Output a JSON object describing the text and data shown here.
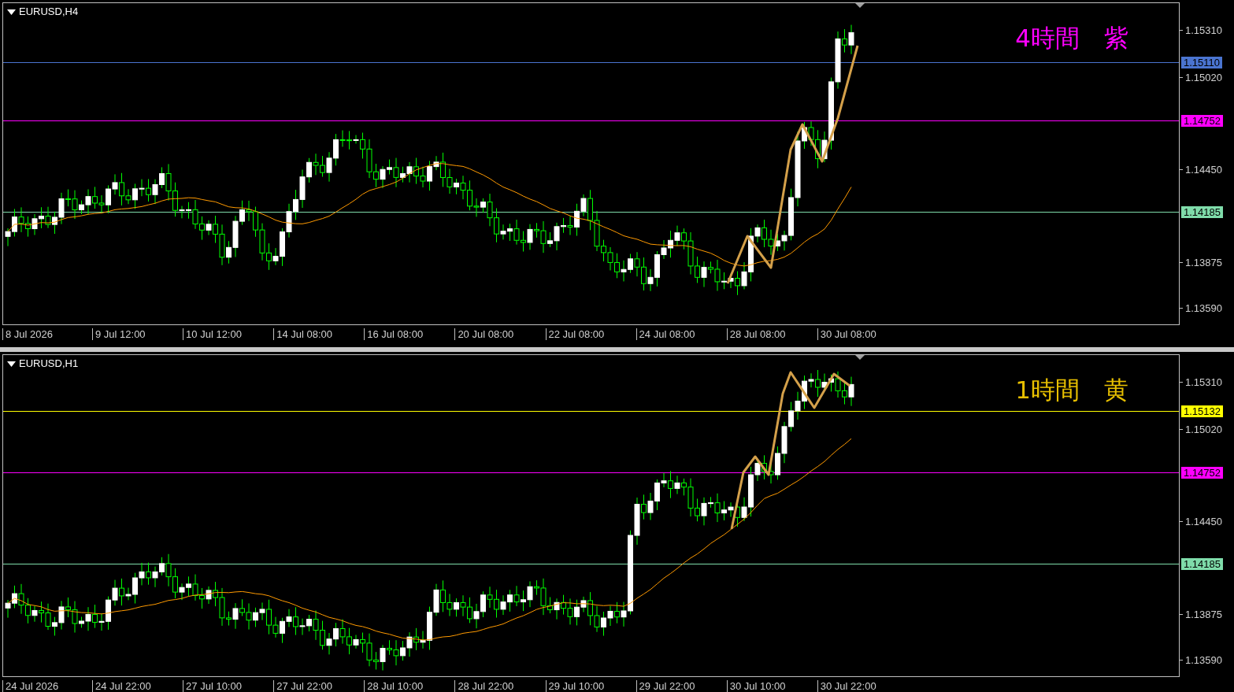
{
  "panels": [
    {
      "title": "EURUSD,H4",
      "annotation": {
        "text": "4時間　紫",
        "color": "#ff00ff"
      },
      "price_labels": [
        {
          "kind": "tick",
          "text": "1.15310"
        },
        {
          "kind": "level",
          "text": "1.15110",
          "color": "#4a74d0"
        },
        {
          "kind": "tick",
          "text": "1.15020"
        },
        {
          "kind": "level",
          "text": "1.14752",
          "color": "#ff00ff"
        },
        {
          "kind": "tick",
          "text": "1.14450"
        },
        {
          "kind": "level",
          "text": "1.14185",
          "color": "#7fdcaa"
        },
        {
          "kind": "tick",
          "text": "1.13875"
        },
        {
          "kind": "tick",
          "text": "1.13590"
        }
      ],
      "time_labels": [
        "8 Jul 2026",
        "9 Jul 12:00",
        "10 Jul 12:00",
        "14 Jul 08:00",
        "16 Jul 08:00",
        "20 Jul 08:00",
        "22 Jul 08:00",
        "24 Jul 08:00",
        "28 Jul 08:00",
        "30 Jul 08:00"
      ]
    },
    {
      "title": "EURUSD,H1",
      "annotation": {
        "text": "1時間　黄",
        "color": "#e8c000"
      },
      "price_labels": [
        {
          "kind": "tick",
          "text": "1.15310"
        },
        {
          "kind": "level",
          "text": "1.15132",
          "color": "#ffff00"
        },
        {
          "kind": "tick",
          "text": "1.15020"
        },
        {
          "kind": "level",
          "text": "1.14752",
          "color": "#ff00ff"
        },
        {
          "kind": "tick",
          "text": "1.14450"
        },
        {
          "kind": "level",
          "text": "1.14185",
          "color": "#7fdcaa"
        },
        {
          "kind": "tick",
          "text": "1.13875"
        },
        {
          "kind": "tick",
          "text": "1.13590"
        }
      ],
      "time_labels": [
        "24 Jul 2026",
        "24 Jul 22:00",
        "27 Jul 10:00",
        "27 Jul 22:00",
        "28 Jul 10:00",
        "28 Jul 22:00",
        "29 Jul 10:00",
        "29 Jul 22:00",
        "30 Jul 10:00",
        "30 Jul 22:00"
      ]
    }
  ]
}
